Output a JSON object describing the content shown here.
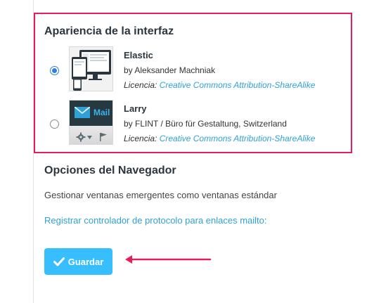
{
  "skin_section": {
    "title": "Apariencia de la interfaz",
    "skins": [
      {
        "name": "Elastic",
        "author": "by Aleksander Machniak",
        "license_label": "Licencia:",
        "license_link": "Creative Commons Attribution-ShareAlike",
        "selected": true
      },
      {
        "name": "Larry",
        "author": "by FLINT / Büro für Gestaltung, Switzerland",
        "license_label": "Licencia:",
        "license_link": "Creative Commons Attribution-ShareAlike",
        "selected": false,
        "thumb_text": "Mail"
      }
    ]
  },
  "browser_section": {
    "title": "Opciones del Navegador",
    "popup_text": "Gestionar ventanas emergentes como ventanas estándar",
    "mailto_link": "Registrar controlador de protocolo para enlaces mailto:"
  },
  "save_button": {
    "label": "Guardar",
    "icon": "check-icon"
  },
  "colors": {
    "accent": "#37beff",
    "link": "#2ea1d8",
    "highlight": "#e41e5a",
    "radio_selected": "#2f7fe0"
  }
}
